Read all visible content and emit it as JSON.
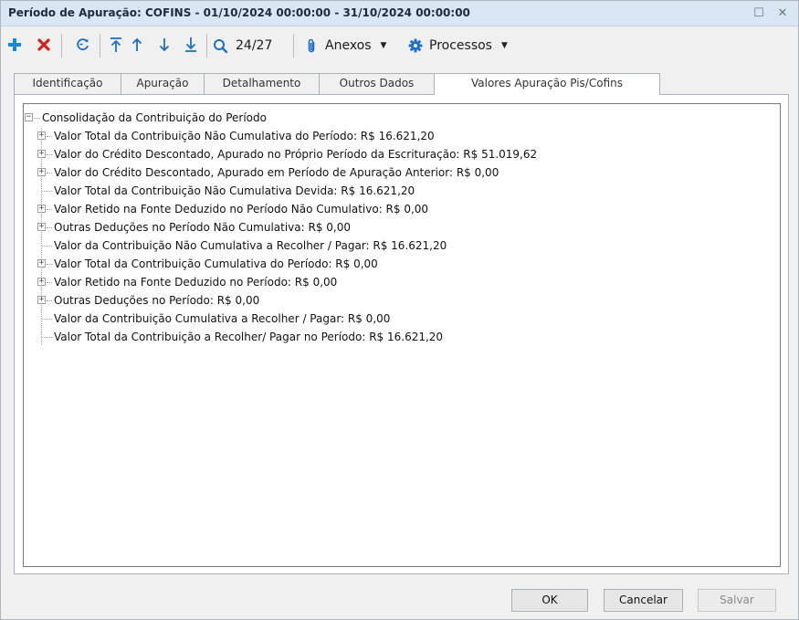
{
  "window": {
    "title": "Período de Apuração: COFINS - 01/10/2024 00:00:00 - 31/10/2024 00:00:00",
    "maximize_glyph": "☐",
    "close_glyph": "✕"
  },
  "toolbar": {
    "add_icon": "plus-icon",
    "delete_icon": "delete-x-icon",
    "refresh_icon": "refresh-icon",
    "first_icon": "arrow-first-icon",
    "prev_icon": "arrow-up-icon",
    "next_icon": "arrow-down-icon",
    "last_icon": "arrow-last-icon",
    "record_position": "24/27",
    "anexos_label": "Anexos",
    "processos_label": "Processos",
    "colors": {
      "add": "#1e88d8",
      "delete": "#d32020",
      "nav": "#1e6fc8"
    }
  },
  "tabs": [
    {
      "label": "Identificação"
    },
    {
      "label": "Apuração"
    },
    {
      "label": "Detalhamento"
    },
    {
      "label": "Outros Dados"
    },
    {
      "label": "Valores Apuração Pis/Cofins"
    }
  ],
  "tree": {
    "root": {
      "label": "Consolidação da Contribuição do Período",
      "expander": "−"
    },
    "children": [
      {
        "label": "Valor Total da Contribuição Não Cumulativa do Período: R$ 16.621,20",
        "expander": "+"
      },
      {
        "label": "Valor do Crédito Descontado, Apurado no Próprio Período da Escrituração: R$ 51.019,62",
        "expander": "+"
      },
      {
        "label": "Valor do Crédito Descontado, Apurado em Período de Apuração Anterior: R$ 0,00",
        "expander": "+"
      },
      {
        "label": "Valor Total da Contribuição Não Cumulativa Devida: R$ 16.621,20",
        "expander": ""
      },
      {
        "label": "Valor Retido na Fonte Deduzido no Período Não Cumulativo: R$ 0,00",
        "expander": "+"
      },
      {
        "label": "Outras Deduções no Período Não Cumulativa: R$ 0,00",
        "expander": "+"
      },
      {
        "label": "Valor da Contribuição Não Cumulativa a Recolher / Pagar: R$ 16.621,20",
        "expander": ""
      },
      {
        "label": "Valor Total da Contribuição Cumulativa do Período: R$ 0,00",
        "expander": "+"
      },
      {
        "label": "Valor Retido na Fonte Deduzido no Período: R$ 0,00",
        "expander": "+"
      },
      {
        "label": "Outras Deduções no Período: R$ 0,00",
        "expander": "+"
      },
      {
        "label": "Valor da Contribuição Cumulativa a Recolher / Pagar: R$ 0,00",
        "expander": ""
      },
      {
        "label": "Valor Total da Contribuição a Recolher/ Pagar no Período: R$ 16.621,20",
        "expander": ""
      }
    ]
  },
  "buttons": {
    "ok": "OK",
    "cancel": "Cancelar",
    "save": "Salvar"
  }
}
